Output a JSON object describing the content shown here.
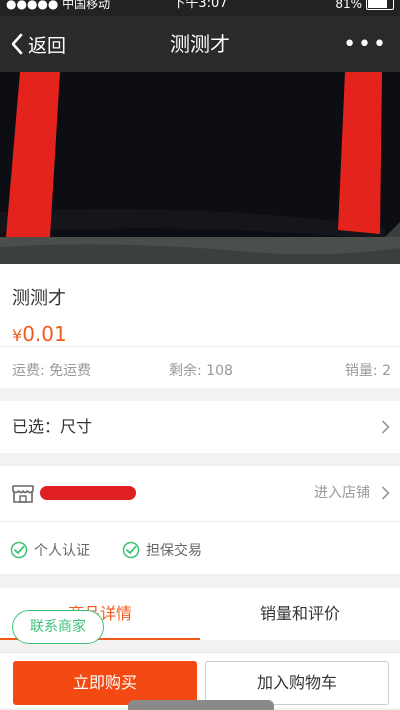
{
  "status_bar": {
    "carrier": "●●●●● 中国移动",
    "time": "下午3:07",
    "battery": "81%"
  },
  "nav": {
    "back_label": "返回",
    "title": "测测才",
    "more": "•••"
  },
  "product": {
    "name": "测测才",
    "price_symbol": "¥",
    "price": "0.01",
    "shipping": "运费: 免运费",
    "stock": "剩余: 108",
    "sales": "销量: 2",
    "image_icon": "product-photo-black-shirt-red-stripes"
  },
  "selection": {
    "label": "已选：尺寸"
  },
  "shop": {
    "enter_label": "进入店铺",
    "badges": [
      "个人认证",
      "担保交易"
    ]
  },
  "tabs": {
    "detail": "商品详情",
    "reviews": "销量和评价"
  },
  "contact": {
    "label": "联系商家"
  },
  "actions": {
    "buy": "立即购买",
    "cart": "加入购物车"
  },
  "colors": {
    "accent": "#f35b1d",
    "green": "#3ec27a",
    "nav": "#2a2a2a"
  }
}
